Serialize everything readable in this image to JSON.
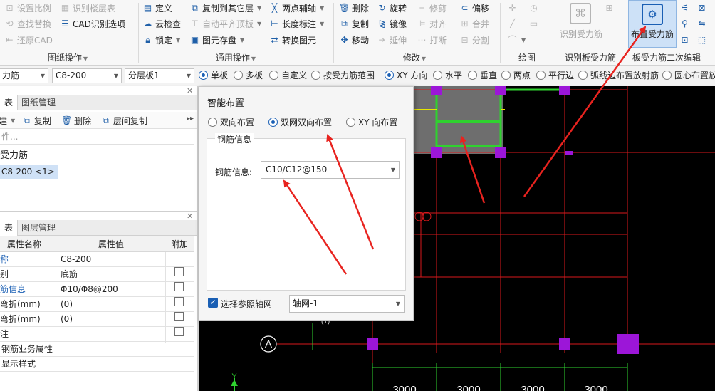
{
  "ribbon": {
    "groups": [
      {
        "label": "图纸操作"
      },
      {
        "label": "通用操作"
      },
      {
        "label": "修改"
      },
      {
        "label": "绘图"
      },
      {
        "label": "识别板受力筋"
      },
      {
        "label": "板受力筋二次编辑"
      }
    ],
    "drawing_ops": [
      "设置比例",
      "识别楼层表",
      "查找替换",
      "CAD识别选项",
      "还原CAD"
    ],
    "common_ops": [
      "定义",
      "复制到其它层",
      "两点辅轴",
      "云检查",
      "自动平齐顶板",
      "长度标注",
      "锁定",
      "图元存盘",
      "转换图元"
    ],
    "modify": [
      "删除",
      "旋转",
      "修剪",
      "偏移",
      "复制",
      "镜像",
      "对齐",
      "合并",
      "移动",
      "延伸",
      "打断",
      "分割"
    ],
    "recognize_label": "识别受力筋",
    "place_label": "布置受力筋"
  },
  "toolbar2": {
    "type_value": "力筋",
    "spec_value": "C8-200",
    "layer_value": "分层板1",
    "radios": [
      {
        "label": "单板",
        "on": true
      },
      {
        "label": "多板",
        "on": false
      },
      {
        "label": "自定义",
        "on": false
      },
      {
        "label": "按受力筋范围",
        "on": false
      },
      {
        "label": "XY 方向",
        "on": true
      },
      {
        "label": "水平",
        "on": false
      },
      {
        "label": "垂直",
        "on": false
      },
      {
        "label": "两点",
        "on": false
      },
      {
        "label": "平行边",
        "on": false
      },
      {
        "label": "弧线边布置放射筋",
        "on": false
      },
      {
        "label": "圆心布置放",
        "on": false
      }
    ]
  },
  "component_panel": {
    "tabs": [
      "表",
      "图纸管理"
    ],
    "actions": [
      "建",
      "复制",
      "删除",
      "层间复制"
    ],
    "search_placeholder": "件...",
    "tree_root": "受力筋",
    "tree_item": "C8-200 <1>"
  },
  "property_panel": {
    "tabs": [
      "表",
      "图层管理"
    ],
    "headers": [
      "属性名称",
      "属性值",
      "附加"
    ],
    "rows": [
      {
        "name": "称",
        "value": "C8-200",
        "checkbox": false,
        "blue": true
      },
      {
        "name": "别",
        "value": "底筋",
        "checkbox": true,
        "blue": false
      },
      {
        "name": "筋信息",
        "value": "Φ10/Φ8@200",
        "checkbox": true,
        "blue": true
      },
      {
        "name": "弯折(mm)",
        "value": "(0)",
        "checkbox": true,
        "blue": false
      },
      {
        "name": "弯折(mm)",
        "value": "(0)",
        "checkbox": true,
        "blue": false
      },
      {
        "name": "注",
        "value": "",
        "checkbox": true,
        "blue": false
      },
      {
        "name": "钢筋业务属性",
        "value": "",
        "checkbox": false,
        "blue": false,
        "expander": true
      },
      {
        "name": "显示样式",
        "value": "",
        "checkbox": false,
        "blue": false,
        "expander": true
      }
    ]
  },
  "dialog": {
    "title": "智能布置",
    "options": [
      {
        "label": "双向布置",
        "on": false
      },
      {
        "label": "双网双向布置",
        "on": true
      },
      {
        "label": "XY 向布置",
        "on": false
      }
    ],
    "group_title": "钢筋信息",
    "field_label": "钢筋信息:",
    "field_value": "C10/C12@150",
    "axis_check_label": "选择参照轴网",
    "axis_checked": true,
    "axis_value": "轴网-1"
  },
  "cad": {
    "axis_label": "A",
    "dims": [
      "3000",
      "3000",
      "3000",
      "3000"
    ],
    "small_label": "(1)",
    "y_label": "Y"
  },
  "colors": {
    "accent": "#1a5fb4",
    "arrow": "#e8231f",
    "grid_red": "#d8191c",
    "rebar_green": "#2fd22f",
    "column_purple": "#9c16d8"
  }
}
